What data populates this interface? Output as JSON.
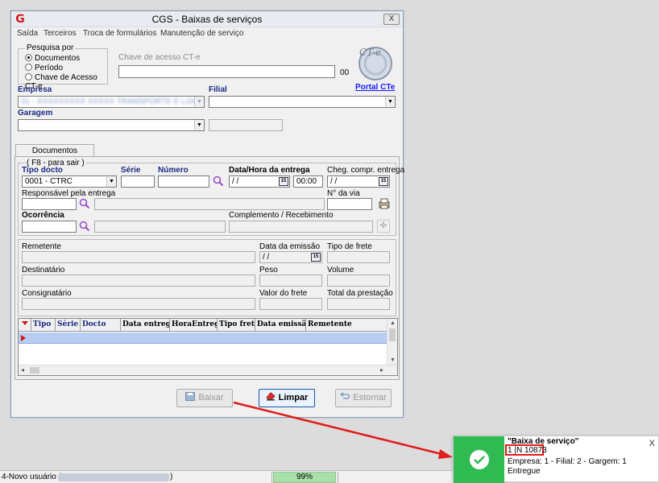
{
  "window": {
    "title": "CGS - Baixas de serviços",
    "close_label": "X"
  },
  "menu": {
    "items": [
      "Saída",
      "Terceiros",
      "Troca de formulários",
      "Manutenção de serviço"
    ]
  },
  "search": {
    "group_label": "Pesquisa por",
    "options": [
      "Documentos",
      "Período",
      "Chave de Acesso CT-e"
    ],
    "selected": "Documentos",
    "chave_label": "Chave de acesso CT-e",
    "chave_value": "",
    "chave_suffix": "00",
    "portal_link": "Portal CTe",
    "cte_logo_text": "CT-e"
  },
  "empresa": {
    "label": "Empresa",
    "value": "01 - XXXXXXXXX XXXXX TRANSPORTE E LOGISTICA L",
    "filial_label": "Filial",
    "filial_value": ""
  },
  "garagem": {
    "label": "Garagem",
    "value": ""
  },
  "tab": {
    "label": "Documentos"
  },
  "documento": {
    "group_label": "( F8 - para sair )",
    "tipo_label": "Tipo docto",
    "tipo_value": "0001 - CTRC",
    "serie_label": "Série",
    "numero_label": "Número",
    "data_entrega_label": "Data/Hora da entrega",
    "data_entrega_value": " / /",
    "hora_entrega_value": "00:00",
    "cheg_label": "Cheg. compr. entrega",
    "cheg_value": " / /",
    "responsavel_label": "Responsável pela entrega",
    "nvia_label": "N° da via",
    "ocorrencia_label": "Ocorrência",
    "complemento_label": "Complemento / Recebimento"
  },
  "info": {
    "remetente_label": "Remetente",
    "data_emissao_label": "Data da emissão",
    "data_emissao_value": " / /",
    "tipo_frete_label": "Tipo de frete",
    "destinatario_label": "Destinatário",
    "peso_label": "Peso",
    "volume_label": "Volume",
    "consignatario_label": "Consignatário",
    "valor_frete_label": "Valor do frete",
    "total_prestacao_label": "Total da prestação"
  },
  "grid": {
    "columns": [
      "Tipo",
      "Série",
      "Docto",
      "Data entrega",
      "HoraEntrega",
      "Tipo frete",
      "Data emissão",
      "Remetente"
    ]
  },
  "buttons": {
    "baixar": "Baixar",
    "limpar": "Limpar",
    "estornar": "Estornar"
  },
  "status": {
    "user_text": "4-Novo usuário (",
    "user_suffix": ")",
    "progress_text": "99%",
    "progress": 0.99
  },
  "toast": {
    "title": "\"Baixa de serviço\"",
    "line1": "1 |N 10873",
    "line2": "Empresa: 1 - Filial: 2 - Gargem: 1",
    "line3": "Entregue",
    "close": "X"
  },
  "colors": {
    "accent_green": "#2fba52",
    "highlight_red": "#e01c1c",
    "label_blue": "#1b2a80",
    "link_blue": "#1a1aff"
  }
}
